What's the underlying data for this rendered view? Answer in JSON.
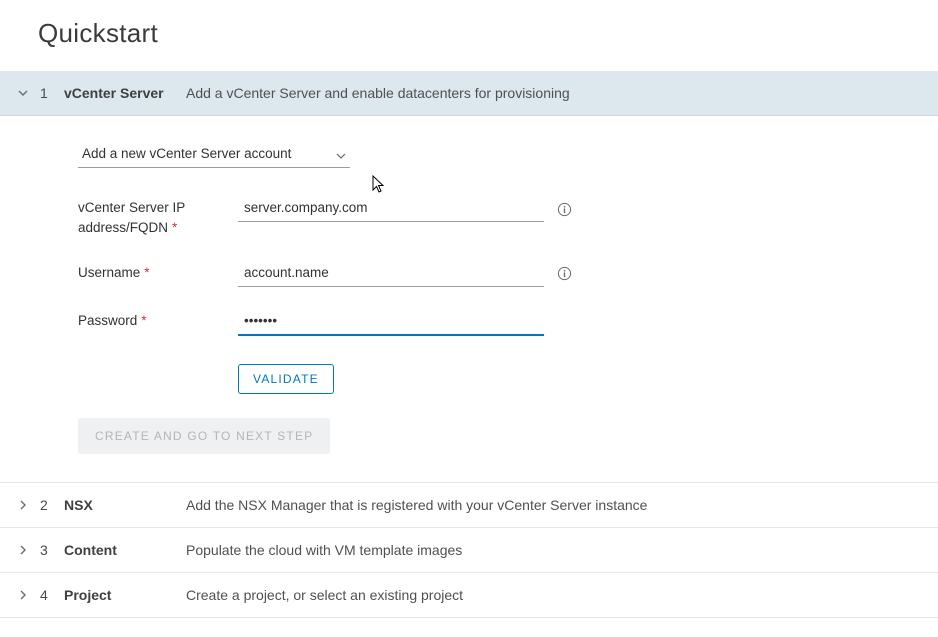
{
  "page": {
    "title": "Quickstart"
  },
  "steps": [
    {
      "num": "1",
      "title": "vCenter Server",
      "desc": "Add a vCenter Server and enable datacenters for provisioning",
      "expanded": true
    },
    {
      "num": "2",
      "title": "NSX",
      "desc": "Add the NSX Manager that is registered with your vCenter Server instance",
      "expanded": false
    },
    {
      "num": "3",
      "title": "Content",
      "desc": "Populate the cloud with VM template images",
      "expanded": false
    },
    {
      "num": "4",
      "title": "Project",
      "desc": "Create a project, or select an existing project",
      "expanded": false
    }
  ],
  "form": {
    "account_select": {
      "selected": "Add a new vCenter Server account"
    },
    "server": {
      "label": "vCenter Server IP address/FQDN",
      "value": "server.company.com"
    },
    "username": {
      "label": "Username",
      "value": "account.name"
    },
    "password": {
      "label": "Password",
      "value": "•••••••"
    },
    "validate_label": "Validate",
    "create_label": "Create and go to next step"
  }
}
